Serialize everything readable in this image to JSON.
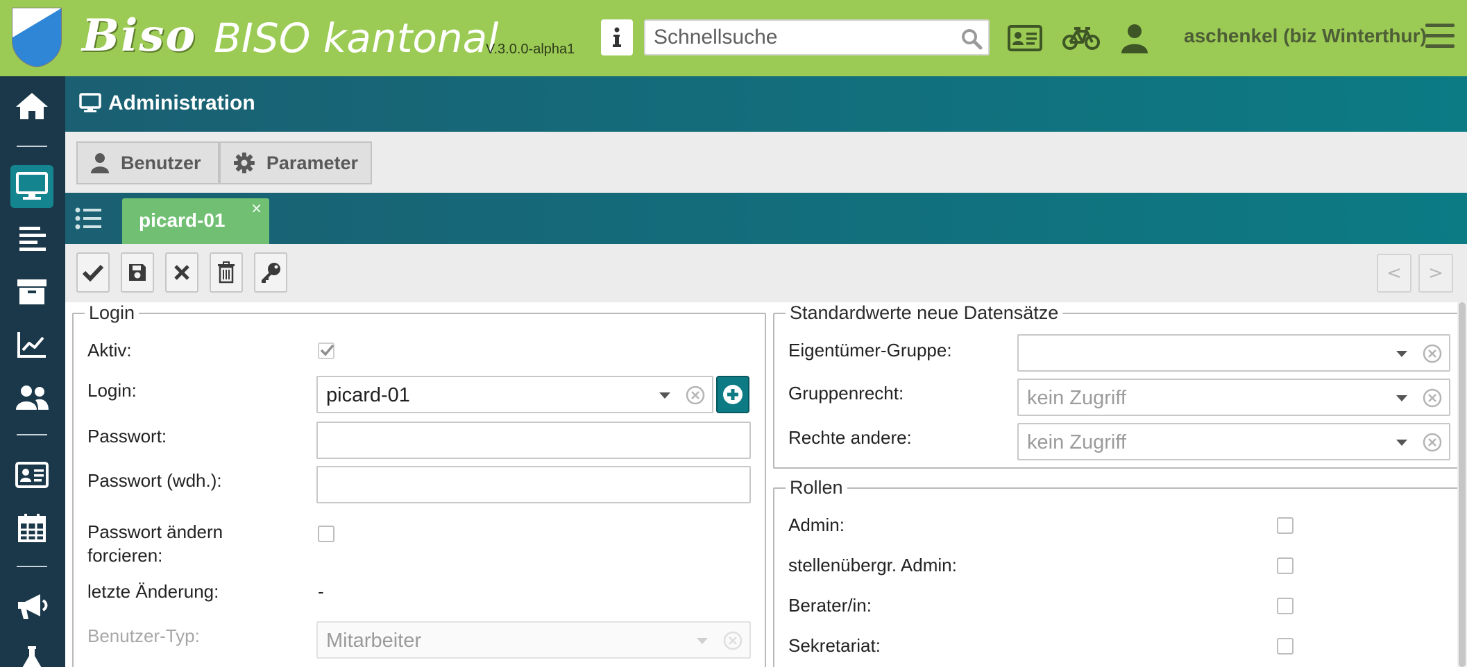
{
  "app": {
    "logo_text": "Biso",
    "title": "BISO kantonal",
    "version": "V.3.0.0-alpha1",
    "search_placeholder": "Schnellsuche",
    "user": "aschenkel (biz Winterthur)",
    "brand_color": "#9ccb55",
    "accent_color": "#0c7b84"
  },
  "top_icons": [
    "info-icon",
    "id-card-icon",
    "bicycle-icon",
    "user-icon",
    "hamburger-menu-icon"
  ],
  "sidebar": {
    "items": [
      {
        "icon": "home-icon",
        "active": false
      },
      {
        "icon": "monitor-icon",
        "active": true
      },
      {
        "icon": "align-left-icon",
        "active": false
      },
      {
        "icon": "archive-icon",
        "active": false
      },
      {
        "icon": "chart-line-icon",
        "active": false
      },
      {
        "icon": "users-icon",
        "active": false
      },
      {
        "icon": "address-card-icon",
        "active": false
      },
      {
        "icon": "calendar-icon",
        "active": false
      },
      {
        "icon": "megaphone-icon",
        "active": false
      },
      {
        "icon": "flask-icon",
        "active": false
      }
    ]
  },
  "header": {
    "title": "Administration",
    "icon": "monitor-icon"
  },
  "section_buttons": [
    {
      "label": "Benutzer",
      "icon": "user-icon"
    },
    {
      "label": "Parameter",
      "icon": "gear-icon"
    }
  ],
  "record_tab": {
    "label": "picard-01",
    "close": "×"
  },
  "toolbar": {
    "buttons": [
      "check-icon",
      "save-icon",
      "cancel-icon",
      "trash-icon",
      "key-icon"
    ],
    "prev": "<",
    "next": ">"
  },
  "login_panel": {
    "legend": "Login",
    "aktiv_label": "Aktiv:",
    "aktiv_checked": true,
    "login_label": "Login:",
    "login_value": "picard-01",
    "passwort_label": "Passwort:",
    "passwort_value": "",
    "passwort_wdh_label": "Passwort (wdh.):",
    "passwort_wdh_value": "",
    "passwort_aendern_label_1": "Passwort ändern",
    "passwort_aendern_label_2": "forcieren:",
    "passwort_aendern_checked": false,
    "letzte_aenderung_label": "letzte Änderung:",
    "letzte_aenderung_value": "-",
    "benutzer_typ_label": "Benutzer-Typ:",
    "benutzer_typ_value": "Mitarbeiter"
  },
  "defaults_panel": {
    "legend": "Standardwerte neue Datensätze",
    "eigentuemer_label": "Eigentümer-Gruppe:",
    "eigentuemer_value": "",
    "gruppenrecht_label": "Gruppenrecht:",
    "gruppenrecht_value": "kein Zugriff",
    "rechte_andere_label": "Rechte andere:",
    "rechte_andere_value": "kein Zugriff"
  },
  "rollen_panel": {
    "legend": "Rollen",
    "roles": [
      {
        "label": "Admin:",
        "checked": false
      },
      {
        "label": "stellenübergr. Admin:",
        "checked": false
      },
      {
        "label": "Berater/in:",
        "checked": false
      },
      {
        "label": "Sekretariat:",
        "checked": false
      }
    ]
  }
}
